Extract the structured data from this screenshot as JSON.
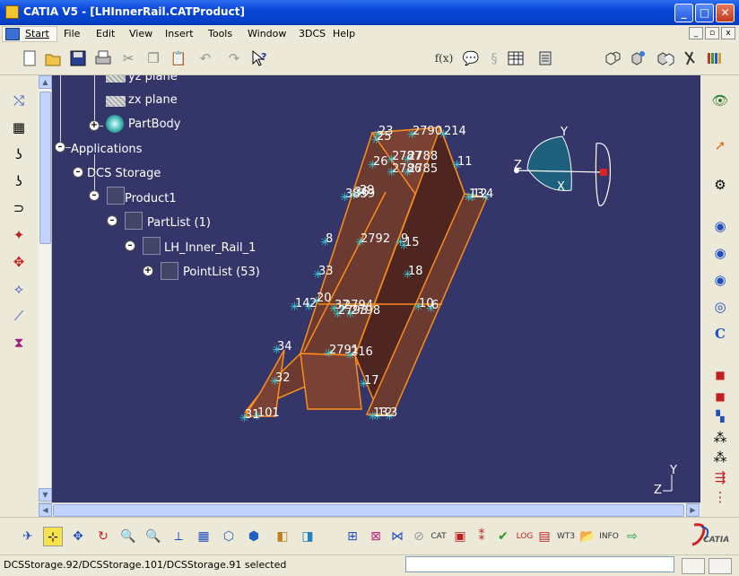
{
  "window": {
    "title": "CATIA V5 - [LHInnerRail.CATProduct]",
    "buttons": {
      "minimize": "_",
      "maximize": "□",
      "close": "✕"
    },
    "inner_buttons": [
      "_",
      "▫",
      "x"
    ]
  },
  "menubar": {
    "items": [
      "Start",
      "File",
      "Edit",
      "View",
      "Insert",
      "Tools",
      "Window",
      "3DCS",
      "Help"
    ]
  },
  "tree": {
    "nodes": [
      {
        "label": "yz plane"
      },
      {
        "label": "zx plane"
      },
      {
        "label": "PartBody"
      },
      {
        "label": "Applications"
      },
      {
        "label": "DCS Storage"
      },
      {
        "label": "Product1"
      },
      {
        "label": "PartList (1)"
      },
      {
        "label": "LH_Inner_Rail_1"
      },
      {
        "label": "PointList (53)"
      }
    ]
  },
  "model": {
    "point_labels": [
      "23",
      "2790",
      "214",
      "25",
      "26",
      "2787",
      "2788",
      "2786",
      "2785",
      "11",
      "13",
      "12",
      "4",
      "3839",
      "29",
      "36",
      "8",
      "2792",
      "9",
      "15",
      "33",
      "18",
      "14",
      "2",
      "20",
      "37",
      "2794",
      "2793",
      "2798",
      "10",
      "6",
      "31",
      "34",
      "2791",
      "216",
      "32",
      "17",
      "101",
      "13",
      "12",
      "3"
    ]
  },
  "compass": {
    "axis_x": "X",
    "axis_y": "Y",
    "axis_z": "Z"
  },
  "status": {
    "text": "DCSStorage.92/DCSStorage.101/DCSStorage.91 selected"
  },
  "logo": {
    "text": "CATIA"
  },
  "colors": {
    "viewport_bg": "#34366a",
    "part_fill": "#6b3a30",
    "part_edge": "#ff8c1a",
    "point_marker": "#30d8e0",
    "titlebar": "#0a46d8"
  }
}
